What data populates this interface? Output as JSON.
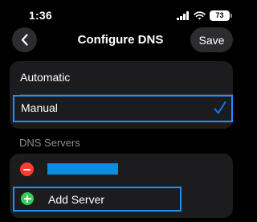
{
  "status_bar": {
    "time": "1:36",
    "battery_level": "73",
    "icons": [
      "signal-icon",
      "wifi-icon",
      "battery-icon"
    ]
  },
  "nav": {
    "title": "Configure DNS",
    "save_label": "Save",
    "back_icon": "chevron-left-icon"
  },
  "mode": {
    "options": [
      {
        "label": "Automatic",
        "selected": false
      },
      {
        "label": "Manual",
        "selected": true
      }
    ],
    "selected_icon": "checkmark-icon"
  },
  "dns_servers": {
    "header": "DNS Servers",
    "add_label": "Add Server",
    "remove_icon": "minus-circle-icon",
    "add_icon": "plus-circle-icon"
  },
  "colors": {
    "accent": "#0a84ff",
    "highlight_border": "#1e90ff",
    "remove": "#ff3b30",
    "add": "#30d158",
    "redaction": "#0a8fe0"
  }
}
